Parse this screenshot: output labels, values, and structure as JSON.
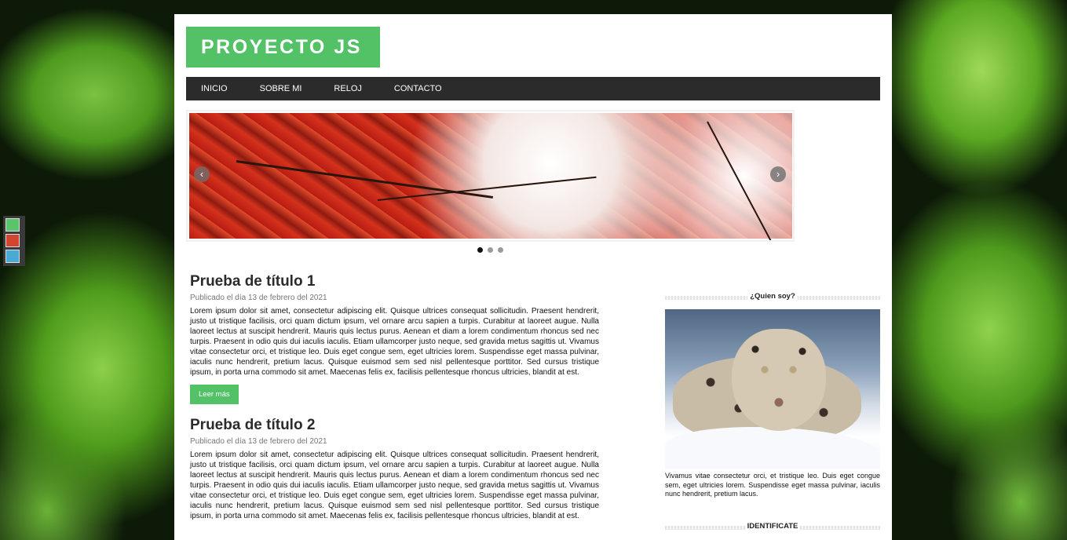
{
  "colors": {
    "accent": "#53c267",
    "menu_bg": "#2b2b2b",
    "swatches": [
      "#5ac46b",
      "#d24530",
      "#4aaad6"
    ]
  },
  "header": {
    "logo": "PROYECTO JS"
  },
  "menu": {
    "items": [
      {
        "label": "INICIO"
      },
      {
        "label": "SOBRE MI"
      },
      {
        "label": "RELOJ"
      },
      {
        "label": "CONTACTO"
      }
    ]
  },
  "slider": {
    "slides": 3,
    "active": 1,
    "prev_icon": "chevron-left-icon",
    "next_icon": "chevron-right-icon"
  },
  "articles": [
    {
      "title": "Prueba de título 1",
      "date": "Publicado el día 13 de febrero del 2021",
      "excerpt": "Lorem ipsum dolor sit amet, consectetur adipiscing elit. Quisque ultrices consequat sollicitudin. Praesent hendrerit, justo ut tristique facilisis, orci quam dictum ipsum, vel ornare arcu sapien a turpis. Curabitur at laoreet augue. Nulla laoreet lectus at suscipit hendrerit. Mauris quis lectus purus. Aenean et diam a lorem condimentum rhoncus sed nec turpis. Praesent in odio quis dui iaculis iaculis. Etiam ullamcorper justo neque, sed gravida metus sagittis ut. Vivamus vitae consectetur orci, et tristique leo. Duis eget congue sem, eget ultricies lorem. Suspendisse eget massa pulvinar, iaculis nunc hendrerit, pretium lacus. Quisque euismod sem sed nisl pellentesque porttitor. Sed cursus tristique ipsum, in porta urna commodo sit amet. Maecenas felis ex, facilisis pellentesque rhoncus ultricies, blandit at est.",
      "button": "Leer más"
    },
    {
      "title": "Prueba de título 2",
      "date": "Publicado el día 13 de febrero del 2021",
      "excerpt": "Lorem ipsum dolor sit amet, consectetur adipiscing elit. Quisque ultrices consequat sollicitudin. Praesent hendrerit, justo ut tristique facilisis, orci quam dictum ipsum, vel ornare arcu sapien a turpis. Curabitur at laoreet augue. Nulla laoreet lectus at suscipit hendrerit. Mauris quis lectus purus. Aenean et diam a lorem condimentum rhoncus sed nec turpis. Praesent in odio quis dui iaculis iaculis. Etiam ullamcorper justo neque, sed gravida metus sagittis ut. Vivamus vitae consectetur orci, et tristique leo. Duis eget congue sem, eget ultricies lorem. Suspendisse eget massa pulvinar, iaculis nunc hendrerit, pretium lacus. Quisque euismod sem sed nisl pellentesque porttitor. Sed cursus tristique ipsum, in porta urna commodo sit amet. Maecenas felis ex, facilisis pellentesque rhoncus ultricies, blandit at est."
    }
  ],
  "sidebar": {
    "about_title": "¿Quien soy?",
    "about_text": "Vivamus vitae consectetur orci, et tristique leo. Duis eget congue sem, eget ultricies lorem. Suspendisse eget massa pulvinar, iaculis nunc hendrerit, pretium lacus.",
    "login_title": "IDENTIFICATE"
  }
}
